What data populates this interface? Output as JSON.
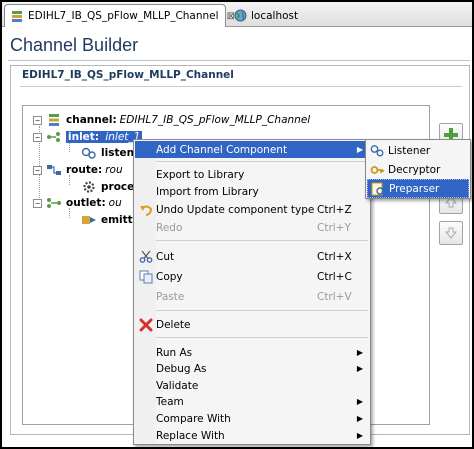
{
  "tabs": [
    {
      "label": "EDIHL7_IB_QS_pFlow_MLLP_Channel",
      "close": "⊠",
      "icon": "channel-file-icon"
    },
    {
      "label": "localhost",
      "icon": "globe-icon"
    }
  ],
  "page": {
    "title": "Channel Builder",
    "section_title": "EDIHL7_IB_QS_pFlow_MLLP_Channel"
  },
  "tree": {
    "channel": {
      "keyword": "channel:",
      "value": "EDIHL7_IB_QS_pFlow_MLLP_Channel"
    },
    "inlet": {
      "keyword": "inlet:",
      "value": "inlet_1"
    },
    "listener": {
      "label": "listene"
    },
    "route": {
      "keyword": "route:",
      "value": "rou"
    },
    "processor": {
      "label": "proce"
    },
    "outlet": {
      "keyword": "outlet:",
      "value": "ou"
    },
    "emitter": {
      "label": "emitte"
    }
  },
  "context_menu": {
    "add_channel_component": "Add Channel Component",
    "export_to_library": "Export to Library",
    "import_from_library": "Import from Library",
    "undo": {
      "label": "Undo Update component type",
      "shortcut": "Ctrl+Z"
    },
    "redo": {
      "label": "Redo",
      "shortcut": "Ctrl+Y"
    },
    "cut": {
      "label": "Cut",
      "shortcut": "Ctrl+X"
    },
    "copy": {
      "label": "Copy",
      "shortcut": "Ctrl+C"
    },
    "paste": {
      "label": "Paste",
      "shortcut": "Ctrl+V"
    },
    "delete": "Delete",
    "run_as": "Run As",
    "debug_as": "Debug As",
    "validate": "Validate",
    "team": "Team",
    "compare_with": "Compare With",
    "replace_with": "Replace With"
  },
  "submenu": {
    "listener": "Listener",
    "decryptor": "Decryptor",
    "preparser": "Preparser"
  },
  "colors": {
    "selection": "#3165c5",
    "title": "#1f3a5c",
    "delete_icon": "#d9302c"
  }
}
